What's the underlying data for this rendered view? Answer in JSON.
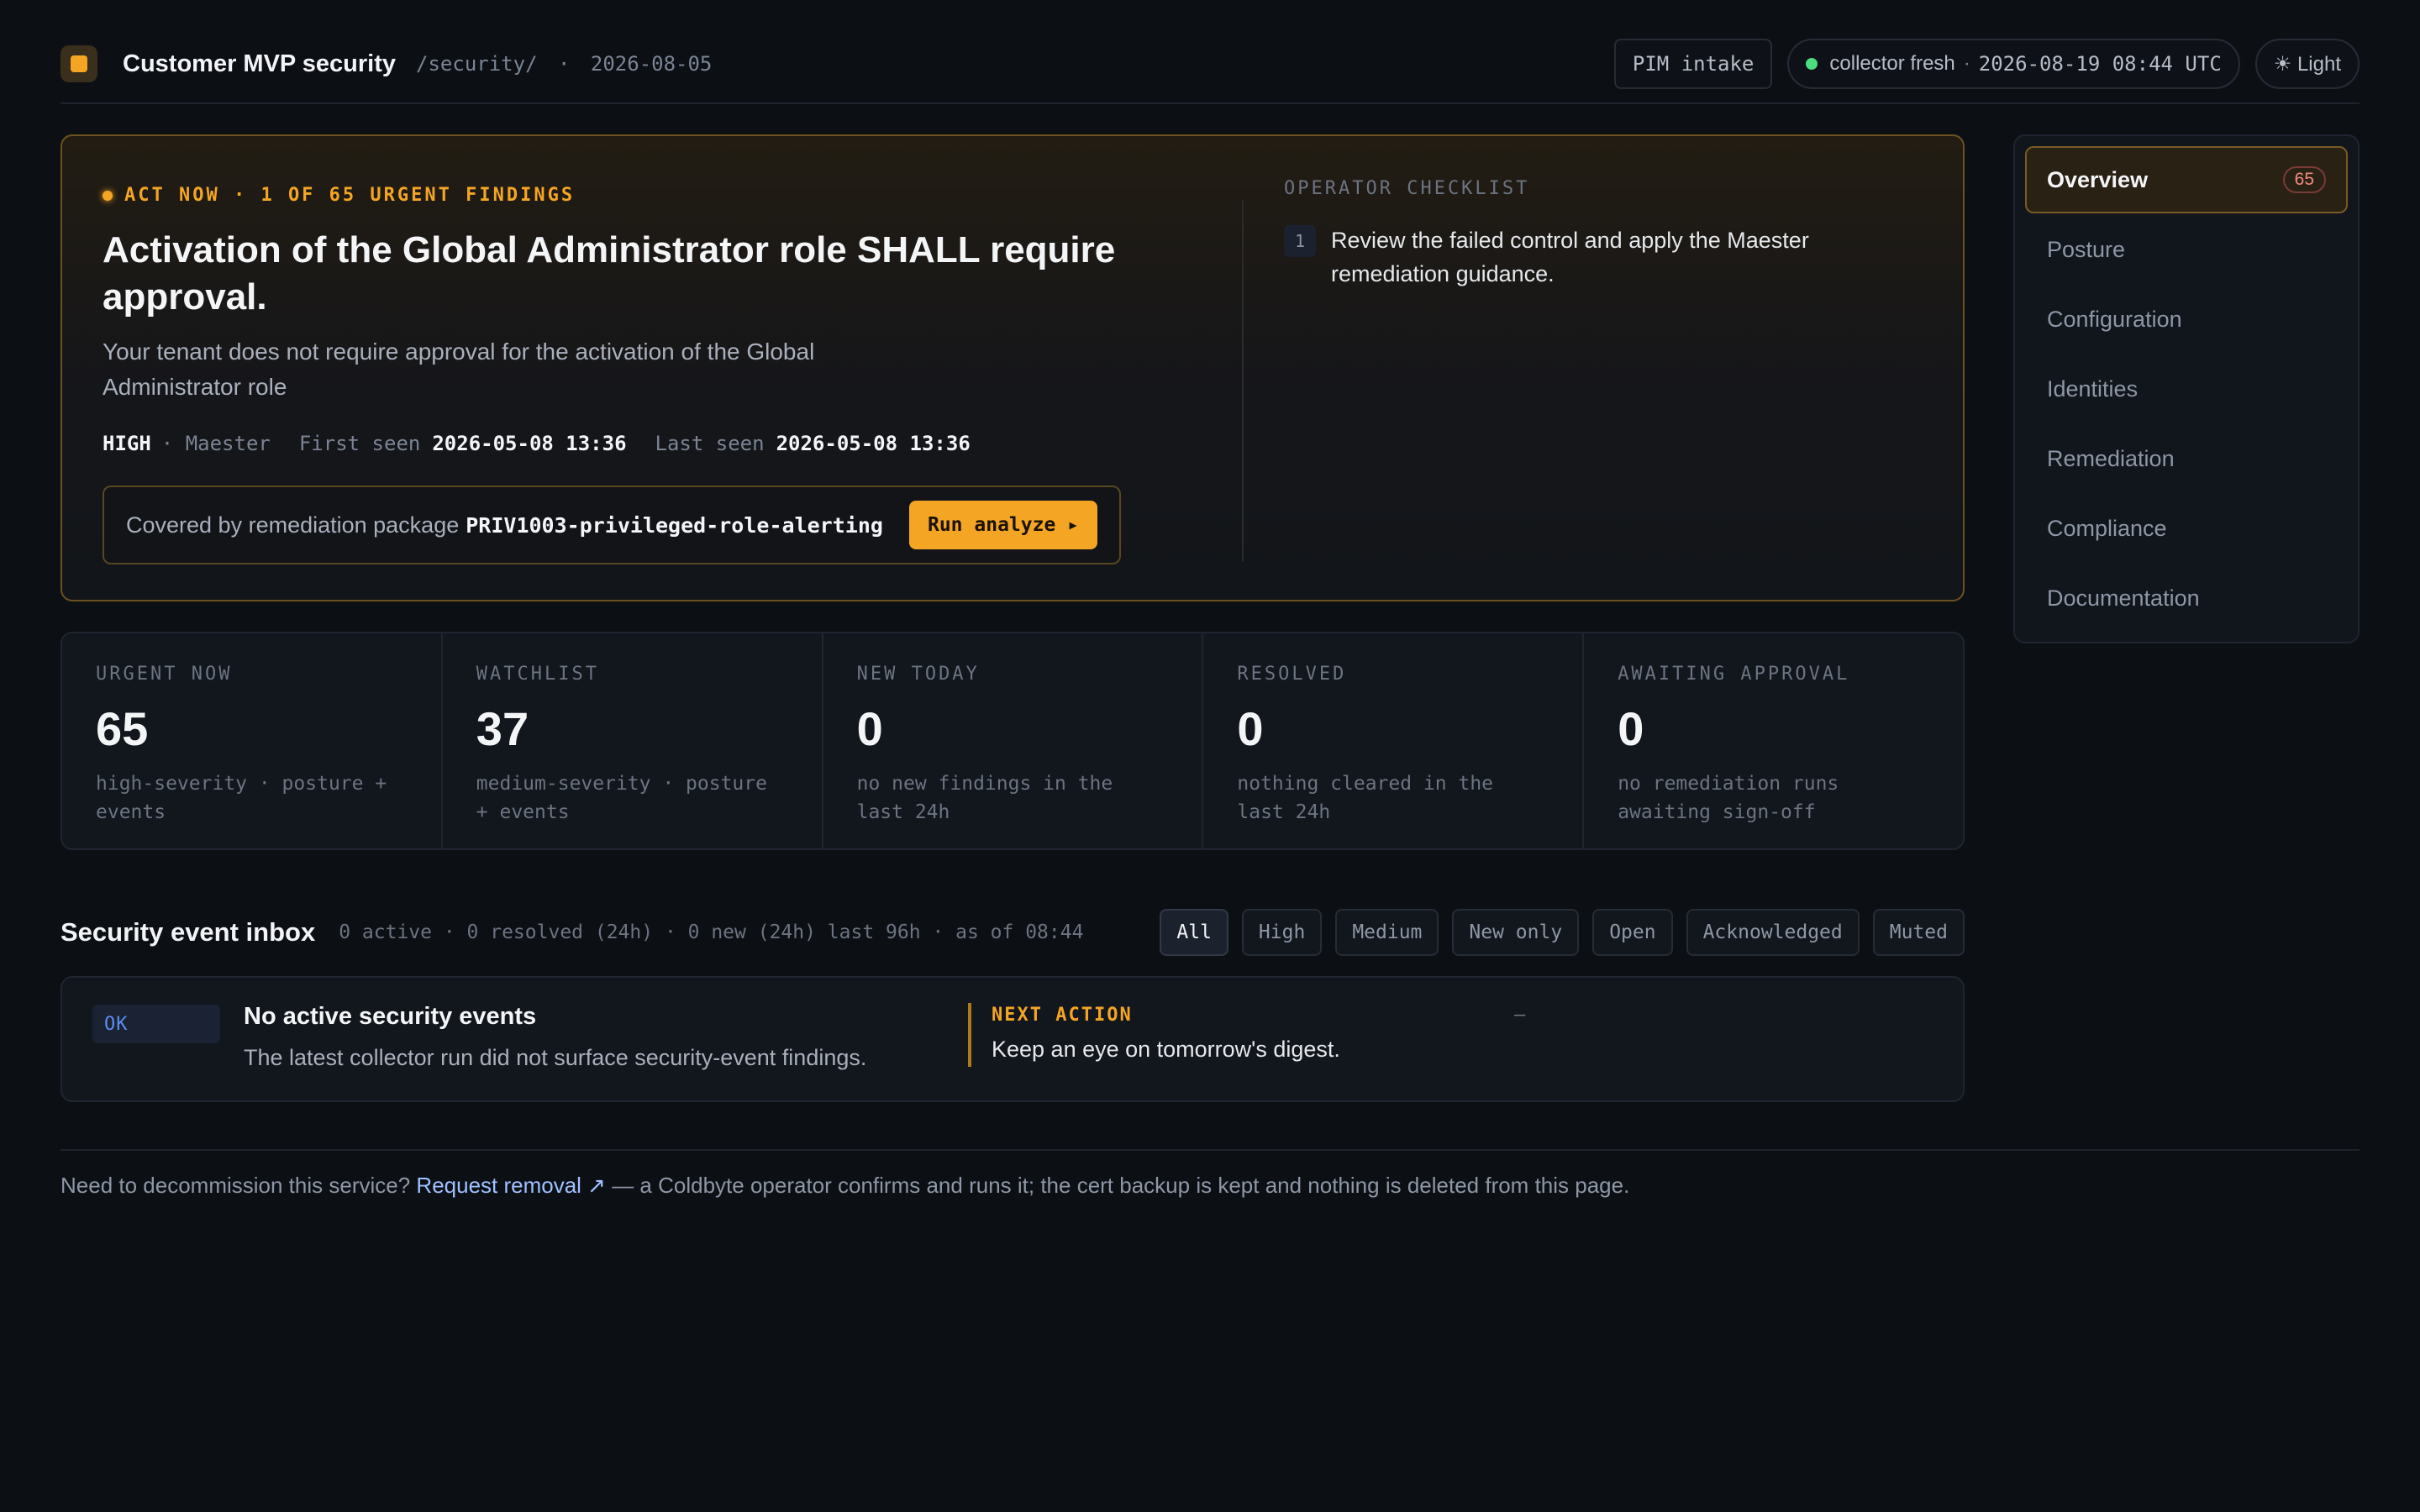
{
  "header": {
    "title": "Customer MVP security",
    "path": "/security/",
    "separator": "·",
    "date": "2026-08-05",
    "pim_label": "PIM intake",
    "collector_status": "collector fresh",
    "collector_sep": "·",
    "collector_time": "2026-08-19 08:44 UTC",
    "theme_toggle": "☀ Light",
    "colors": {
      "accent": "#f5a524",
      "status_ok": "#4ade80"
    }
  },
  "hero": {
    "eyebrow": "ACT NOW · 1 OF 65 URGENT FINDINGS",
    "title": "Activation of the Global Administrator role SHALL require approval.",
    "description": "Your tenant does not require approval for the activation of the Global Administrator role",
    "severity": "HIGH",
    "source": "· Maester",
    "first_seen_label": "First seen",
    "first_seen": "2026-05-08 13:36",
    "last_seen_label": "Last seen",
    "last_seen": "2026-05-08 13:36",
    "package_text": "Covered by remediation package",
    "package_name": "PRIV1003-privileged-role-alerting",
    "run_button": "Run analyze ▸",
    "checklist_title": "OPERATOR CHECKLIST",
    "checklist": [
      {
        "num": "1",
        "text": "Review the failed control and apply the Maester remediation guidance."
      }
    ]
  },
  "nav": {
    "items": [
      {
        "label": "Overview",
        "badge": "65",
        "active": true
      },
      {
        "label": "Posture"
      },
      {
        "label": "Configuration"
      },
      {
        "label": "Identities"
      },
      {
        "label": "Remediation"
      },
      {
        "label": "Compliance"
      },
      {
        "label": "Documentation"
      }
    ]
  },
  "stats": [
    {
      "label": "URGENT NOW",
      "value": "65",
      "sub": "high-severity · posture + events"
    },
    {
      "label": "WATCHLIST",
      "value": "37",
      "sub": "medium-severity · posture + events"
    },
    {
      "label": "NEW TODAY",
      "value": "0",
      "sub": "no new findings in the last 24h"
    },
    {
      "label": "RESOLVED",
      "value": "0",
      "sub": "nothing cleared in the last 24h"
    },
    {
      "label": "AWAITING APPROVAL",
      "value": "0",
      "sub": "no remediation runs awaiting sign-off"
    }
  ],
  "inbox": {
    "title": "Security event inbox",
    "meta": "0 active · 0 resolved (24h) · 0 new (24h)  last 96h · as of 08:44",
    "filters": [
      "All",
      "High",
      "Medium",
      "New only",
      "Open",
      "Acknowledged",
      "Muted"
    ],
    "event": {
      "badge": "OK",
      "title": "No active security events",
      "description": "The latest collector run did not surface security-event findings.",
      "next_action_label": "NEXT ACTION",
      "next_action": "Keep an eye on tomorrow's digest.",
      "dash": "–"
    }
  },
  "footer": {
    "prefix": "Need to decommission this service?",
    "link": "Request removal ↗",
    "suffix": "— a Coldbyte operator confirms and runs it; the cert backup is kept and nothing is deleted from this page."
  }
}
